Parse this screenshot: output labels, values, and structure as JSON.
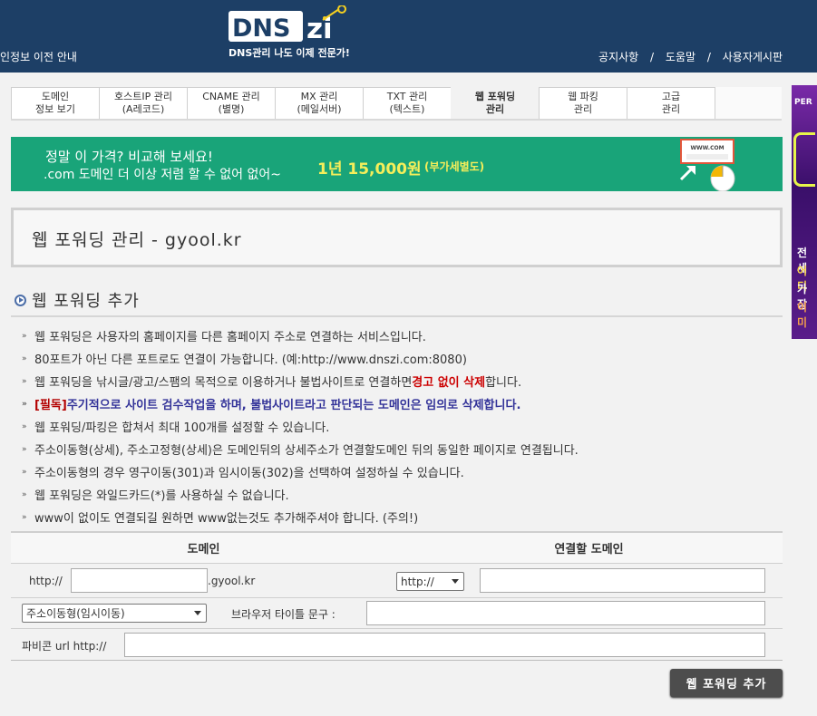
{
  "header": {
    "left_link": "인정보 이전 안내",
    "logo_text": "DNSzi",
    "tagline": "DNS관리 나도 이제 전문가!",
    "links": [
      "공지사항",
      "도움말",
      "사용자게시판"
    ],
    "separator": "/"
  },
  "tabs": [
    {
      "line1": "도메인",
      "line2": "정보 보기"
    },
    {
      "line1": "호스트IP 관리",
      "line2": "(A레코드)"
    },
    {
      "line1": "CNAME 관리",
      "line2": "(별명)"
    },
    {
      "line1": "MX 관리",
      "line2": "(메일서버)"
    },
    {
      "line1": "TXT 관리",
      "line2": "(텍스트)"
    },
    {
      "line1": "웹 포워딩",
      "line2": "관리",
      "active": true
    },
    {
      "line1": "웹 파킹",
      "line2": "관리"
    },
    {
      "line1": "고급",
      "line2": "관리"
    }
  ],
  "banner": {
    "line1": "정말 이 가격? 비교해 보세요!",
    "line2": ".com 도메인 더 이상 저렴 할 수 없어 없어~",
    "price": "1년 15,000원",
    "vat": "(부가세별도)",
    "www_label": "WWW.COM"
  },
  "page_title": "웹 포워딩 관리 - gyool.kr",
  "section_title": "웹 포워딩 추가",
  "notes": [
    {
      "text": "웹 포워딩은 사용자의 홈페이지를 다른 홈페이지 주소로 연결하는 서비스입니다."
    },
    {
      "text": "80포트가 아닌 다른 포트로도 연결이 가능합니다. (예:http://www.dnszi.com:8080)"
    },
    {
      "before": "웹 포워딩을 낚시글/광고/스팸의 목적으로 이용하거나 불법사이트로 연결하면 ",
      "red": "경고 없이 삭제",
      "after": "합니다."
    },
    {
      "tag": "[필독]",
      "text": "주기적으로 사이트 검수작업을 하며, 불법사이트라고 판단되는 도메인은 임의로 삭제합니다."
    },
    {
      "text": "웹 포워딩/파킹은 합쳐서 최대 100개를 설정할 수 있습니다."
    },
    {
      "text": "주소이동형(상세), 주소고정형(상세)은 도메인뒤의 상세주소가 연결할도메인 뒤의 동일한 페이지로 연결됩니다."
    },
    {
      "text": "주소이동형의 경우 영구이동(301)과 임시이동(302)을 선택하여 설정하실 수 있습니다."
    },
    {
      "text": "웹 포워딩은 와일드카드(*)를 사용하실 수 없습니다."
    },
    {
      "text": "www이 없이도 연결되길 원하면 www없는것도 추가해주셔야 합니다. (주의!)"
    }
  ],
  "form": {
    "col_domain": "도메인",
    "col_target": "연결할 도메인",
    "prefix": "http://",
    "domain_suffix": ".gyool.kr",
    "domain_value": "",
    "protocol_select": "http://",
    "target_value": "",
    "type_select": "주소이동형(임시이동)",
    "browser_title_label": "브라우저 타이틀 문구 :",
    "browser_title_value": "",
    "favicon_label": "파비콘 url http://",
    "favicon_value": "",
    "submit_label": "웹 포워딩 추가"
  },
  "side_ad": {
    "top": "PER",
    "lines": [
      "전세",
      "어디",
      "가장",
      "이미"
    ]
  },
  "colors": {
    "header_bg": "#1d3f66",
    "banner_bg": "#19a479",
    "price_yellow": "#f5ee5a",
    "warn_red": "#cc0000",
    "notice_navy": "#333399"
  }
}
